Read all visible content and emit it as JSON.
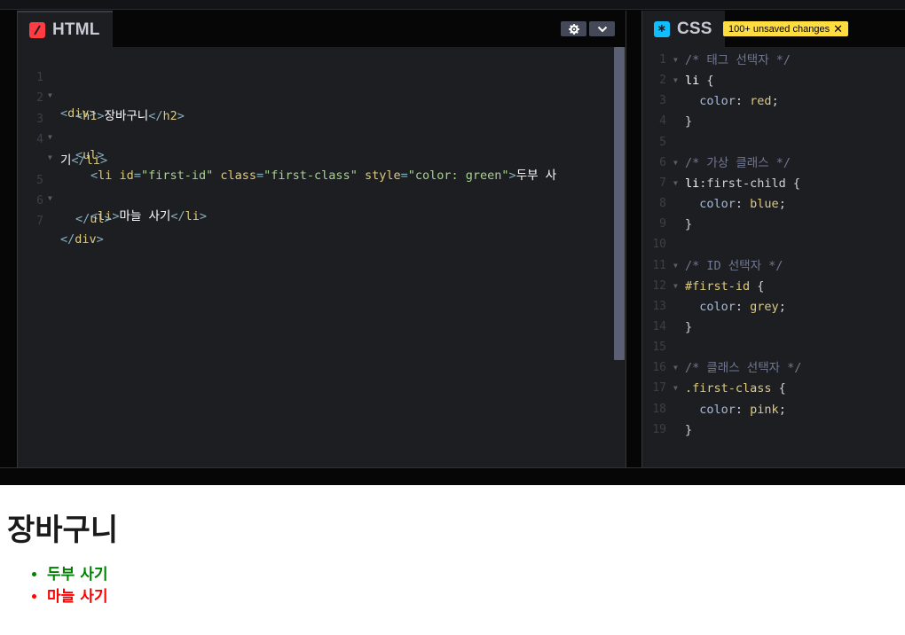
{
  "html_pane": {
    "tab_label": "HTML",
    "icon": "html-slash-icon",
    "icon_color": "#ff3c41",
    "settings_icon": "gear-icon",
    "collapse_icon": "chevron-down-icon",
    "line_numbers": [
      "1",
      "2",
      "3",
      "4",
      "",
      "5",
      "6",
      "7"
    ],
    "lines": {
      "l1": {
        "a": "<",
        "b": "div",
        "c": ">"
      },
      "l2": {
        "a": "<",
        "b": "h1",
        "c": ">",
        "d": "장바구니",
        "e": "</",
        "f": "h2",
        "g": ">"
      },
      "l3": {
        "a": "<",
        "b": "ul",
        "c": ">"
      },
      "l4": {
        "a": "<",
        "b": "li",
        "sp1": " ",
        "attr1": "id",
        "eq1": "=",
        "str1": "\"first-id\"",
        "sp2": " ",
        "attr2": "class",
        "eq2": "=",
        "str2": "\"first-class\"",
        "sp3": " ",
        "attr3": "style",
        "eq3": "=",
        "str3": "\"color: green\"",
        "c": ">",
        "d": "두부 사"
      },
      "l4b": {
        "d": "기",
        "e": "</",
        "f": "li",
        "g": ">"
      },
      "l5": {
        "a": "<",
        "b": "li",
        "c": ">",
        "d": "마늘 사기",
        "e": "</",
        "f": "li",
        "g": ">"
      },
      "l6": {
        "a": "</",
        "b": "ul",
        "c": ">"
      },
      "l7": {
        "a": "</",
        "b": "div",
        "c": ">"
      }
    }
  },
  "css_pane": {
    "tab_label": "CSS",
    "icon": "asterisk-icon",
    "icon_color": "#0ebeff",
    "badge_text": "100+ unsaved changes",
    "badge_close": "✕",
    "badge_color": "#ffdd40",
    "lines": [
      {
        "n": "1",
        "fold": true,
        "parts": [
          [
            "t-comment",
            "/* 태그 선택자 */"
          ]
        ]
      },
      {
        "n": "2",
        "fold": true,
        "parts": [
          [
            "t-sel",
            "li"
          ],
          [
            "t-plain",
            " {"
          ]
        ]
      },
      {
        "n": "3",
        "fold": false,
        "parts": [
          [
            "t-plain",
            "  "
          ],
          [
            "t-prop",
            "color"
          ],
          [
            "t-plain",
            ": "
          ],
          [
            "t-val",
            "red"
          ],
          [
            "t-plain",
            ";"
          ]
        ]
      },
      {
        "n": "4",
        "fold": false,
        "parts": [
          [
            "t-plain",
            "}"
          ]
        ]
      },
      {
        "n": "5",
        "fold": false,
        "parts": []
      },
      {
        "n": "6",
        "fold": true,
        "parts": [
          [
            "t-comment",
            "/* 가상 클래스 */"
          ]
        ]
      },
      {
        "n": "7",
        "fold": true,
        "parts": [
          [
            "t-sel",
            "li"
          ],
          [
            "t-plain",
            ":first-child {"
          ]
        ]
      },
      {
        "n": "8",
        "fold": false,
        "parts": [
          [
            "t-plain",
            "  "
          ],
          [
            "t-prop",
            "color"
          ],
          [
            "t-plain",
            ": "
          ],
          [
            "t-val",
            "blue"
          ],
          [
            "t-plain",
            ";"
          ]
        ]
      },
      {
        "n": "9",
        "fold": false,
        "parts": [
          [
            "t-plain",
            "}"
          ]
        ]
      },
      {
        "n": "10",
        "fold": false,
        "parts": []
      },
      {
        "n": "11",
        "fold": true,
        "parts": [
          [
            "t-comment",
            "/* ID 선택자 */"
          ]
        ]
      },
      {
        "n": "12",
        "fold": true,
        "parts": [
          [
            "t-sel-id",
            "#first-id"
          ],
          [
            "t-plain",
            " {"
          ]
        ]
      },
      {
        "n": "13",
        "fold": false,
        "parts": [
          [
            "t-plain",
            "  "
          ],
          [
            "t-prop",
            "color"
          ],
          [
            "t-plain",
            ": "
          ],
          [
            "t-val",
            "grey"
          ],
          [
            "t-plain",
            ";"
          ]
        ]
      },
      {
        "n": "14",
        "fold": false,
        "parts": [
          [
            "t-plain",
            "}"
          ]
        ]
      },
      {
        "n": "15",
        "fold": false,
        "parts": []
      },
      {
        "n": "16",
        "fold": true,
        "parts": [
          [
            "t-comment",
            "/* 클래스 선택자 */"
          ]
        ]
      },
      {
        "n": "17",
        "fold": true,
        "parts": [
          [
            "t-sel-id",
            ".first-class"
          ],
          [
            "t-plain",
            " {"
          ]
        ]
      },
      {
        "n": "18",
        "fold": false,
        "parts": [
          [
            "t-plain",
            "  "
          ],
          [
            "t-prop",
            "color"
          ],
          [
            "t-plain",
            ": "
          ],
          [
            "t-val",
            "pink"
          ],
          [
            "t-plain",
            ";"
          ]
        ]
      },
      {
        "n": "19",
        "fold": false,
        "parts": [
          [
            "t-plain",
            "}"
          ]
        ]
      }
    ]
  },
  "preview": {
    "heading": "장바구니",
    "items": [
      "두부 사기",
      "마늘 사기"
    ],
    "item_colors": [
      "#008000",
      "#ff0000"
    ]
  }
}
